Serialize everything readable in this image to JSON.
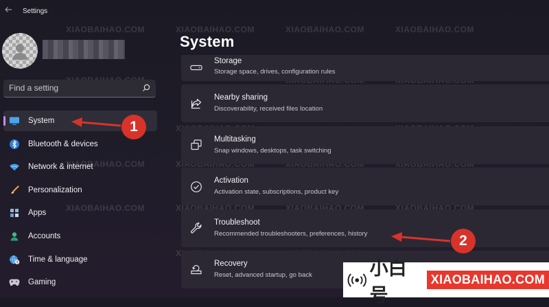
{
  "window": {
    "title": "Settings"
  },
  "search": {
    "placeholder": "Find a setting"
  },
  "nav": {
    "items": [
      {
        "label": "System"
      },
      {
        "label": "Bluetooth & devices"
      },
      {
        "label": "Network & internet"
      },
      {
        "label": "Personalization"
      },
      {
        "label": "Apps"
      },
      {
        "label": "Accounts"
      },
      {
        "label": "Time & language"
      },
      {
        "label": "Gaming"
      }
    ]
  },
  "main": {
    "title": "System",
    "cards": [
      {
        "title": "Storage",
        "desc": "Storage space, drives, configuration rules",
        "icon": "storage-icon"
      },
      {
        "title": "Nearby sharing",
        "desc": "Discoverability, received files location",
        "icon": "share-icon"
      },
      {
        "title": "Multitasking",
        "desc": "Snap windows, desktops, task switching",
        "icon": "multitasking-icon"
      },
      {
        "title": "Activation",
        "desc": "Activation state, subscriptions, product key",
        "icon": "check-circle-icon"
      },
      {
        "title": "Troubleshoot",
        "desc": "Recommended troubleshooters, preferences, history",
        "icon": "wrench-icon"
      },
      {
        "title": "Recovery",
        "desc": "Reset, advanced startup, go back",
        "icon": "recovery-icon"
      }
    ]
  },
  "annotations": {
    "badge1": "1",
    "badge2": "2"
  },
  "watermark": {
    "cn": "小白号",
    "latin": "XIAOBAIHAO.COM",
    "accent": "#e8382e"
  },
  "colors": {
    "accent": "#c58ee6",
    "annotation": "#d8332a"
  }
}
